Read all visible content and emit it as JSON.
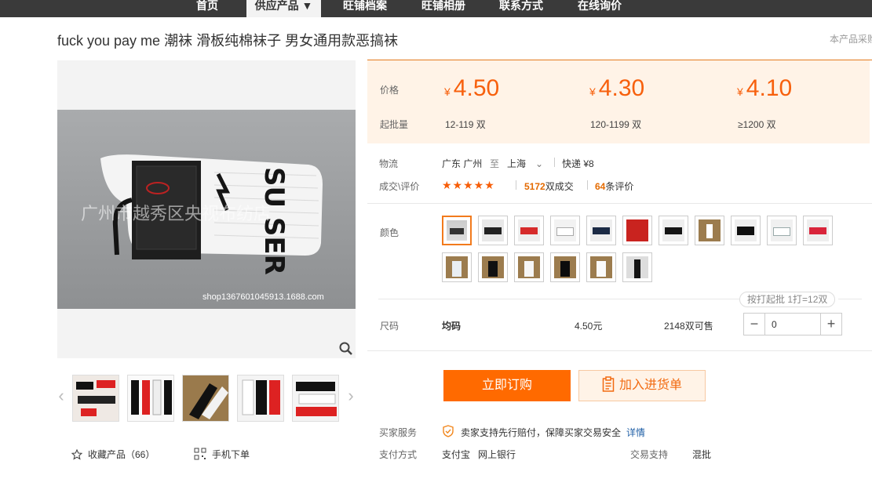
{
  "nav": {
    "items": [
      "首页",
      "供应产品 ▼",
      "旺铺档案",
      "旺铺相册",
      "联系方式",
      "在线询价"
    ]
  },
  "product": {
    "title": "fuck you pay me 潮袜 滑板纯棉袜子 男女通用款恶搞袜",
    "note": "本产品采购",
    "image_watermark": "广州市越秀区央视布纺店",
    "image_url_text": "shop1367601045913.1688.com",
    "sock_print": "SU SER"
  },
  "gallery": {
    "favorite_label": "收藏产品（66）",
    "mobile_label": "手机下单",
    "icons": {
      "prev": "chevron-left-icon",
      "next": "chevron-right-icon",
      "zoom": "magnifier-icon",
      "favorite": "star-outline-icon",
      "mobile": "qr-code-icon"
    }
  },
  "price": {
    "price_label": "价格",
    "moq_label": "起批量",
    "currency": "¥",
    "tiers": [
      {
        "price": "4.50",
        "range": "12-119 双"
      },
      {
        "price": "4.30",
        "range": "120-1199 双"
      },
      {
        "price": "4.10",
        "range": "≥1200 双"
      }
    ],
    "accent": "#f7600d",
    "background": "#fff3e7"
  },
  "logistics": {
    "label": "物流",
    "from": "广东 广州",
    "to_word": "至",
    "to": "上海",
    "shipping": "快递 ¥8"
  },
  "deals": {
    "label": "成交\\评价",
    "stars": "★★★★★",
    "count": "5172",
    "count_unit": "双成交",
    "reviews": "64",
    "reviews_unit": "条评价"
  },
  "color": {
    "label": "颜色",
    "selected_index": 0
  },
  "sku": {
    "hint": "按打起批 1打=12双",
    "size_label": "尺码",
    "size": "均码",
    "price": "4.50元",
    "stock": "2148双可售",
    "quantity": "0",
    "minus": "−",
    "plus": "+"
  },
  "actions": {
    "buy_now": "立即订购",
    "add_to_cart": "加入进货单"
  },
  "service": {
    "label": "买家服务",
    "text": "卖家支持先行赔付，保障买家交易安全",
    "link": "详情",
    "icon": "shield-icon"
  },
  "payment": {
    "label": "支付方式",
    "methods": [
      "支付宝",
      "网上银行"
    ],
    "trade_label": "交易支持",
    "trade_value": "混批"
  }
}
